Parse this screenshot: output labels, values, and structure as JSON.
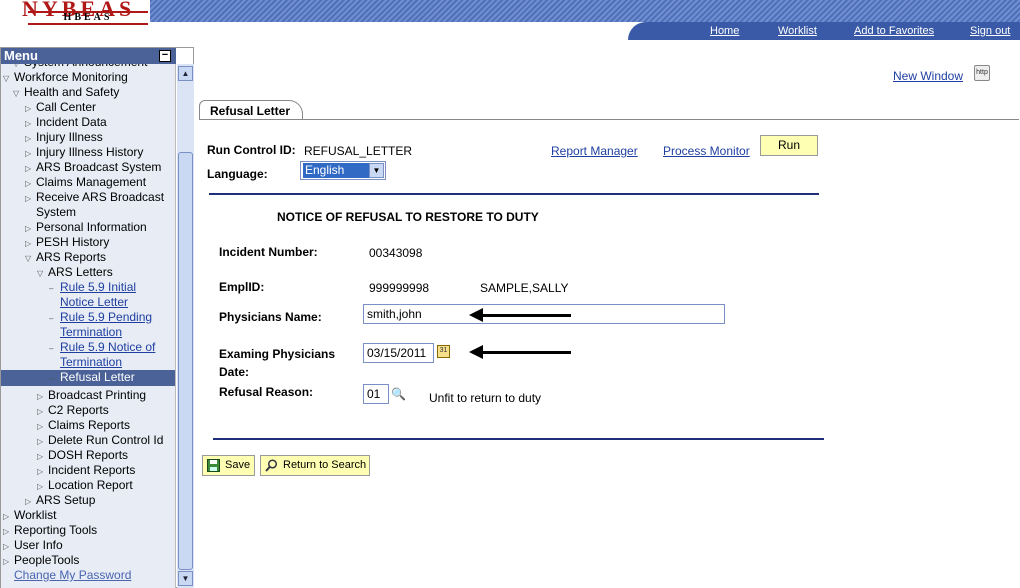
{
  "header": {
    "logo_line1": "NYBEAS",
    "logo_line2": "HBEAS",
    "nav": [
      "Home",
      "Worklist",
      "Add to Favorites",
      "Sign out"
    ]
  },
  "menu": {
    "title": "Menu",
    "items": [
      {
        "label": "System Announcement",
        "type": "folder-open",
        "level": 1
      },
      {
        "label": "Workforce Monitoring",
        "type": "folder-open",
        "level": 0
      },
      {
        "label": "Health and Safety",
        "type": "folder-open",
        "level": 1
      },
      {
        "label": "Call Center",
        "type": "folder",
        "level": 2
      },
      {
        "label": "Incident Data",
        "type": "folder",
        "level": 2
      },
      {
        "label": "Injury Illness",
        "type": "folder",
        "level": 2
      },
      {
        "label": "Injury Illness History",
        "type": "folder",
        "level": 2
      },
      {
        "label": "ARS Broadcast System",
        "type": "folder",
        "level": 2
      },
      {
        "label": "Claims Management",
        "type": "folder",
        "level": 2
      },
      {
        "label": "Receive ARS Broadcast",
        "type": "folder",
        "level": 2
      },
      {
        "label": "System",
        "type": "cont",
        "level": 2
      },
      {
        "label": "Personal Information",
        "type": "folder",
        "level": 2
      },
      {
        "label": "PESH History",
        "type": "folder",
        "level": 2
      },
      {
        "label": "ARS Reports",
        "type": "folder-open",
        "level": 2
      },
      {
        "label": "ARS Letters",
        "type": "folder-open",
        "level": 3
      },
      {
        "label": "Rule 5.9 Initial",
        "type": "link",
        "level": 4
      },
      {
        "label": "Notice Letter",
        "type": "link-cont",
        "level": 4
      },
      {
        "label": "Rule 5.9 Pending",
        "type": "link",
        "level": 4
      },
      {
        "label": "Termination",
        "type": "link-cont",
        "level": 4
      },
      {
        "label": "Rule 5.9 Notice of",
        "type": "link",
        "level": 4
      },
      {
        "label": "Termination",
        "type": "link-cont",
        "level": 4
      },
      {
        "label": "Refusal Letter",
        "type": "selected",
        "level": 4
      },
      {
        "label": "Broadcast Printing",
        "type": "folder",
        "level": 3
      },
      {
        "label": "C2 Reports",
        "type": "folder",
        "level": 3
      },
      {
        "label": "Claims Reports",
        "type": "folder",
        "level": 3
      },
      {
        "label": "Delete Run Control Id",
        "type": "folder",
        "level": 3
      },
      {
        "label": "DOSH Reports",
        "type": "folder",
        "level": 3
      },
      {
        "label": "Incident Reports",
        "type": "folder",
        "level": 3
      },
      {
        "label": "Location Report",
        "type": "folder",
        "level": 3
      },
      {
        "label": "ARS Setup",
        "type": "folder",
        "level": 2
      },
      {
        "label": "Worklist",
        "type": "folder",
        "level": 0
      },
      {
        "label": "Reporting Tools",
        "type": "folder",
        "level": 0
      },
      {
        "label": "User Info",
        "type": "folder",
        "level": 0
      },
      {
        "label": "PeopleTools",
        "type": "folder",
        "level": 0
      },
      {
        "label": "Change My Password",
        "type": "link-plain",
        "level": 0
      }
    ]
  },
  "content": {
    "new_window": "New Window",
    "tab": "Refusal Letter",
    "run_control_label": "Run Control ID:",
    "run_control_value": "REFUSAL_LETTER",
    "report_manager": "Report Manager",
    "process_monitor": "Process Monitor",
    "run_button": "Run",
    "language_label": "Language:",
    "language_value": "English",
    "notice_title": "NOTICE OF REFUSAL TO RESTORE TO DUTY",
    "incident_label": "Incident Number:",
    "incident_value": "00343098",
    "emplid_label": "EmplID:",
    "emplid_value": "999999998",
    "emp_name": "SAMPLE,SALLY",
    "physicians_label": "Physicians Name:",
    "physicians_value": "smith,john",
    "exam_label_line1": "Examing Physicians",
    "exam_label_line2": "Date:",
    "exam_date": "03/15/2011",
    "refusal_label": "Refusal Reason:",
    "refusal_code": "01",
    "refusal_desc": "Unfit to return to duty",
    "save_button": "Save",
    "return_button": "Return to Search"
  },
  "colors": {
    "header_blue": "#3a5aa8",
    "menu_bg": "#e7ecf5",
    "link": "#1f3fa0",
    "button": "#ffffb3"
  },
  "icons": [
    "http-icon",
    "calendar-icon",
    "lookup-icon",
    "save-icon",
    "search-icon"
  ]
}
